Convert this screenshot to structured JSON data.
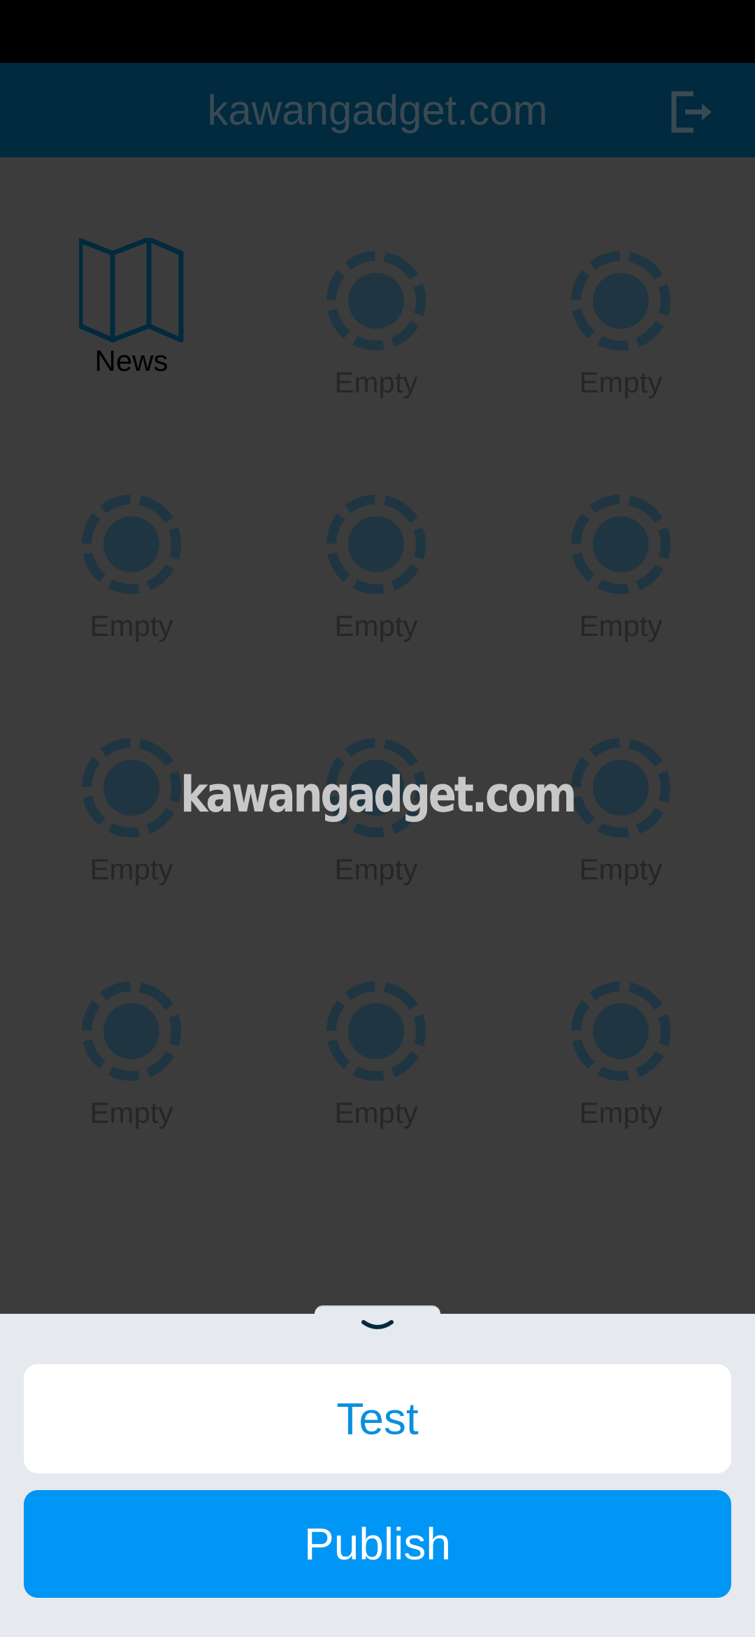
{
  "header": {
    "title": "kawangadget.com",
    "logout_icon": "logout-icon"
  },
  "grid": {
    "items": [
      {
        "label": "News",
        "icon": "map-icon",
        "state": "filled"
      },
      {
        "label": "Empty",
        "icon": "empty-slot-icon",
        "state": "empty"
      },
      {
        "label": "Empty",
        "icon": "empty-slot-icon",
        "state": "empty"
      },
      {
        "label": "Empty",
        "icon": "empty-slot-icon",
        "state": "empty"
      },
      {
        "label": "Empty",
        "icon": "empty-slot-icon",
        "state": "empty"
      },
      {
        "label": "Empty",
        "icon": "empty-slot-icon",
        "state": "empty"
      },
      {
        "label": "Empty",
        "icon": "empty-slot-icon",
        "state": "empty"
      },
      {
        "label": "Empty",
        "icon": "empty-slot-icon",
        "state": "empty"
      },
      {
        "label": "Empty",
        "icon": "empty-slot-icon",
        "state": "empty"
      },
      {
        "label": "Empty",
        "icon": "empty-slot-icon",
        "state": "empty"
      },
      {
        "label": "Empty",
        "icon": "empty-slot-icon",
        "state": "empty"
      },
      {
        "label": "Empty",
        "icon": "empty-slot-icon",
        "state": "empty"
      }
    ]
  },
  "watermark": "kawangadget.com",
  "bottom_sheet": {
    "handle_icon": "chevron-down-icon",
    "test_label": "Test",
    "publish_label": "Publish"
  },
  "colors": {
    "header_bg": "#022a3e",
    "icon_dark": "#022a3e",
    "publish_bg": "#0096f5",
    "test_text": "#0a8fde"
  }
}
